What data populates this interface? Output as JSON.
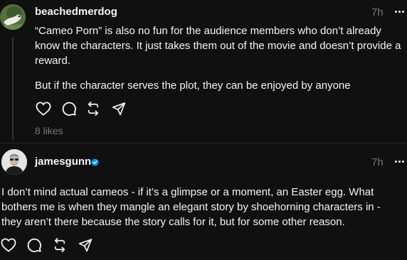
{
  "post1": {
    "username": "beachedmerdog",
    "time": "7h",
    "paragraphs": [
      "“Cameo Porn” is also no fun for the audience members who don’t already know the characters. It just takes them out of the movie and doesn’t provide a reward.",
      "But if the character serves the plot, they can be enjoyed by anyone"
    ],
    "likes": "8 likes",
    "actions": [
      "heart-icon",
      "comment-icon",
      "repost-icon",
      "share-icon"
    ]
  },
  "post2": {
    "username": "jamesgunn",
    "verified": true,
    "time": "7h",
    "body": "I don’t mind actual cameos - if it’s a glimpse or a moment, an Easter egg. What bothers me is when they mangle an elegant story by shoehorning characters in - they aren’t there because the story calls for it, but for some other reason.",
    "actions": [
      "heart-icon",
      "comment-icon",
      "repost-icon",
      "share-icon"
    ]
  },
  "colors": {
    "background": "#101010",
    "text": "#f3f5f7",
    "secondary": "#777777",
    "verified": "#0095f6",
    "thread_line": "#333638"
  }
}
